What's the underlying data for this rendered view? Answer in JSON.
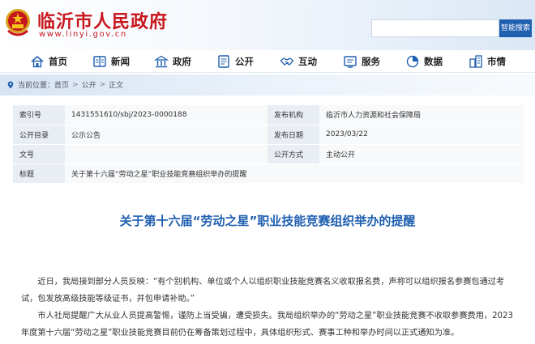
{
  "site": {
    "name": "临沂市人民政府",
    "url": "www.linyi.gov.cn"
  },
  "search": {
    "placeholder": "",
    "button_label": "智能搜索"
  },
  "nav": {
    "items": [
      {
        "label": "首页",
        "icon": "home-icon"
      },
      {
        "label": "新闻",
        "icon": "news-icon"
      },
      {
        "label": "政府",
        "icon": "government-icon"
      },
      {
        "label": "公开",
        "icon": "disclosure-icon"
      },
      {
        "label": "互动",
        "icon": "handshake-icon"
      },
      {
        "label": "服务",
        "icon": "service-icon"
      },
      {
        "label": "数据",
        "icon": "data-icon"
      },
      {
        "label": "市情",
        "icon": "city-icon"
      }
    ]
  },
  "breadcrumb": {
    "prefix": "当前位置：",
    "items": [
      "首页",
      "公开",
      "正文"
    ],
    "separator": ">"
  },
  "info": {
    "index_label": "索引号",
    "index_value": "1431551610/sbj/2023-0000188",
    "publisher_label": "发布机构",
    "publisher_value": "临沂市人力资源和社会保障局",
    "catalog_label": "公开目录",
    "catalog_value": "公示公告",
    "date_label": "发布日期",
    "date_value": "2023/03/22",
    "docno_label": "文号",
    "docno_value": "",
    "method_label": "公开方式",
    "method_value": "主动公开",
    "subject_label": "标题",
    "subject_value": "关于第十六届“劳动之星”职业技能竞赛组织举办的提醒"
  },
  "article": {
    "title": "关于第十六届“劳动之星”职业技能竞赛组织举办的提醒",
    "paragraphs": [
      "近日，我局接到部分人员反映：“有个别机构、单位或个人以组织职业技能竞赛名义收取报名费，声称可以组织报名参赛包通过考试，包发放高级技能等级证书，并包申请补助。”",
      "市人社局提醒广大从业人员提高警惕，谨防上当受骗，遭受损失。我局组织举办的“劳动之星”职业技能竞赛不收取参赛费用，2023年度第十六届“劳动之星”职业技能竞赛目前仍在筹备策划过程中，具体组织形式、赛事工种和举办时间以正式通知为准。"
    ]
  },
  "colors": {
    "brand_red": "#c8161d",
    "accent_blue": "#1f5fb0"
  }
}
